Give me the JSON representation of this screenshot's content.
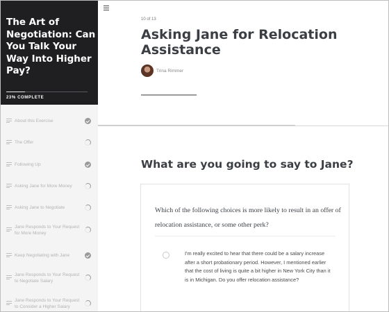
{
  "course": {
    "title": "The Art of Negotiation: Can You Talk Your Way Into Higher Pay?",
    "progress_text": "23% COMPLETE",
    "progress_fraction": 0.23
  },
  "sidebar": {
    "items": [
      {
        "label": "About this Exercise",
        "status": "complete"
      },
      {
        "label": "The Offer",
        "status": "incomplete"
      },
      {
        "label": "Following Up",
        "status": "complete"
      },
      {
        "label": "Asking Jane for More Money",
        "status": "incomplete"
      },
      {
        "label": "Asking Jane to Negotiate",
        "status": "incomplete"
      },
      {
        "label": "Jane Responds to Your Request for More Money",
        "status": "incomplete"
      },
      {
        "label": "Keep Negotiating with Jane",
        "status": "complete"
      },
      {
        "label": "Jane Responds to Your Request to Negotiate Salary",
        "status": "incomplete"
      },
      {
        "label": "Jane Responds to Your Request to Consider a Higher Salary",
        "status": "incomplete"
      }
    ]
  },
  "lesson": {
    "count": "10 of 13",
    "title": "Asking Jane for Relocation Assistance",
    "author": "Trina Rimmer"
  },
  "question": {
    "heading": "What are you going to say to Jane?",
    "prompt": "Which of the following choices is more likely to result in an offer of relocation assistance, or some other perk?",
    "choices": [
      {
        "text": "I'm really excited to hear that there could be a salary increase after a short probationary period. However, I mentioned earlier that the cost of living is quite a bit higher in New York City than it is in Michigan. Do you offer relocation assistance?"
      }
    ]
  },
  "icons": {
    "menu": "hamburger-icon",
    "lesson": "lines-icon",
    "complete": "check-circle-icon",
    "incomplete": "partial-circle-icon"
  },
  "colors": {
    "sidebar_header": "#1f1f22",
    "sidebar_bg": "#f4f4f4",
    "title_text": "#3b3f44"
  }
}
